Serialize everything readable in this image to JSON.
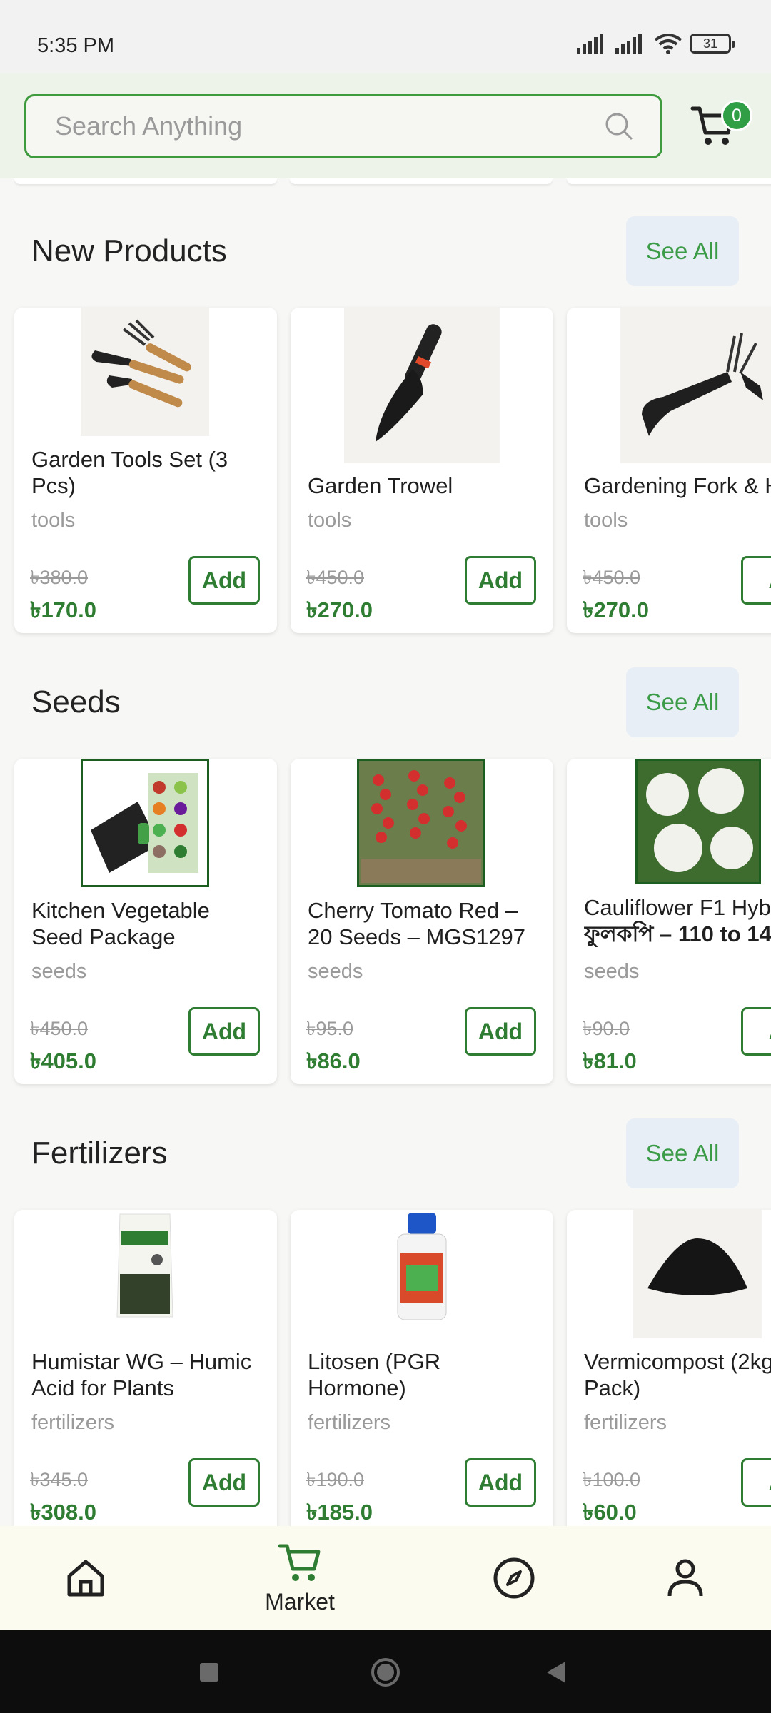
{
  "status": {
    "time": "5:35 PM",
    "battery": "31"
  },
  "search": {
    "placeholder": "Search Anything"
  },
  "cart": {
    "count": "0"
  },
  "sections": [
    {
      "title": "New Products",
      "see_all": "See All",
      "products": [
        {
          "name_line1": "Garden Tools Set (3",
          "name_line2": "Pcs)",
          "category": "tools",
          "old_price": "৳380.0",
          "price": "৳170.0",
          "add": "Add",
          "image": "garden-tools-set-image"
        },
        {
          "name_line1": "Garden Trowel",
          "name_line2": "",
          "category": "tools",
          "old_price": "৳450.0",
          "price": "৳270.0",
          "add": "Add",
          "image": "garden-trowel-image"
        },
        {
          "name_line1": "Gardening Fork & H",
          "name_line2": "",
          "category": "tools",
          "old_price": "৳450.0",
          "price": "৳270.0",
          "add": "A",
          "image": "gardening-fork-image"
        }
      ]
    },
    {
      "title": "Seeds",
      "see_all": "See All",
      "products": [
        {
          "name_line1": "Kitchen Vegetable",
          "name_line2": "Seed Package",
          "category": "seeds",
          "old_price": "৳450.0",
          "price": "৳405.0",
          "add": "Add",
          "image": "kitchen-seed-package-image"
        },
        {
          "name_line1": "Cherry Tomato Red –",
          "name_line2": "20 Seeds – MGS1297",
          "category": "seeds",
          "old_price": "৳95.0",
          "price": "৳86.0",
          "add": "Add",
          "image": "cherry-tomato-image"
        },
        {
          "name_line1": "Cauliflower F1 Hybr",
          "name_line2": "ফুলকপি – 110 to 14",
          "category": "seeds",
          "old_price": "৳90.0",
          "price": "৳81.0",
          "add": "A",
          "image": "cauliflower-image"
        }
      ]
    },
    {
      "title": "Fertilizers",
      "see_all": "See All",
      "products": [
        {
          "name_line1": "Humistar WG – Humic",
          "name_line2": "Acid for Plants",
          "category": "fertilizers",
          "old_price": "৳345.0",
          "price": "৳308.0",
          "add": "Add",
          "image": "humistar-bag-image"
        },
        {
          "name_line1": "Litosen (PGR",
          "name_line2": "Hormone)",
          "category": "fertilizers",
          "old_price": "৳190.0",
          "price": "৳185.0",
          "add": "Add",
          "image": "litosen-bottle-image"
        },
        {
          "name_line1": "Vermicompost (2kg",
          "name_line2": "Pack)",
          "category": "fertilizers",
          "old_price": "৳100.0",
          "price": "৳60.0",
          "add": "A",
          "image": "vermicompost-image"
        }
      ]
    }
  ],
  "nav": {
    "home_icon": "home-icon",
    "market_label": "Market",
    "explore_icon": "compass-icon",
    "profile_icon": "user-icon"
  },
  "colors": {
    "accent": "#2e7d32",
    "see_all_text": "#3b9b47",
    "badge": "#2f9e44"
  }
}
